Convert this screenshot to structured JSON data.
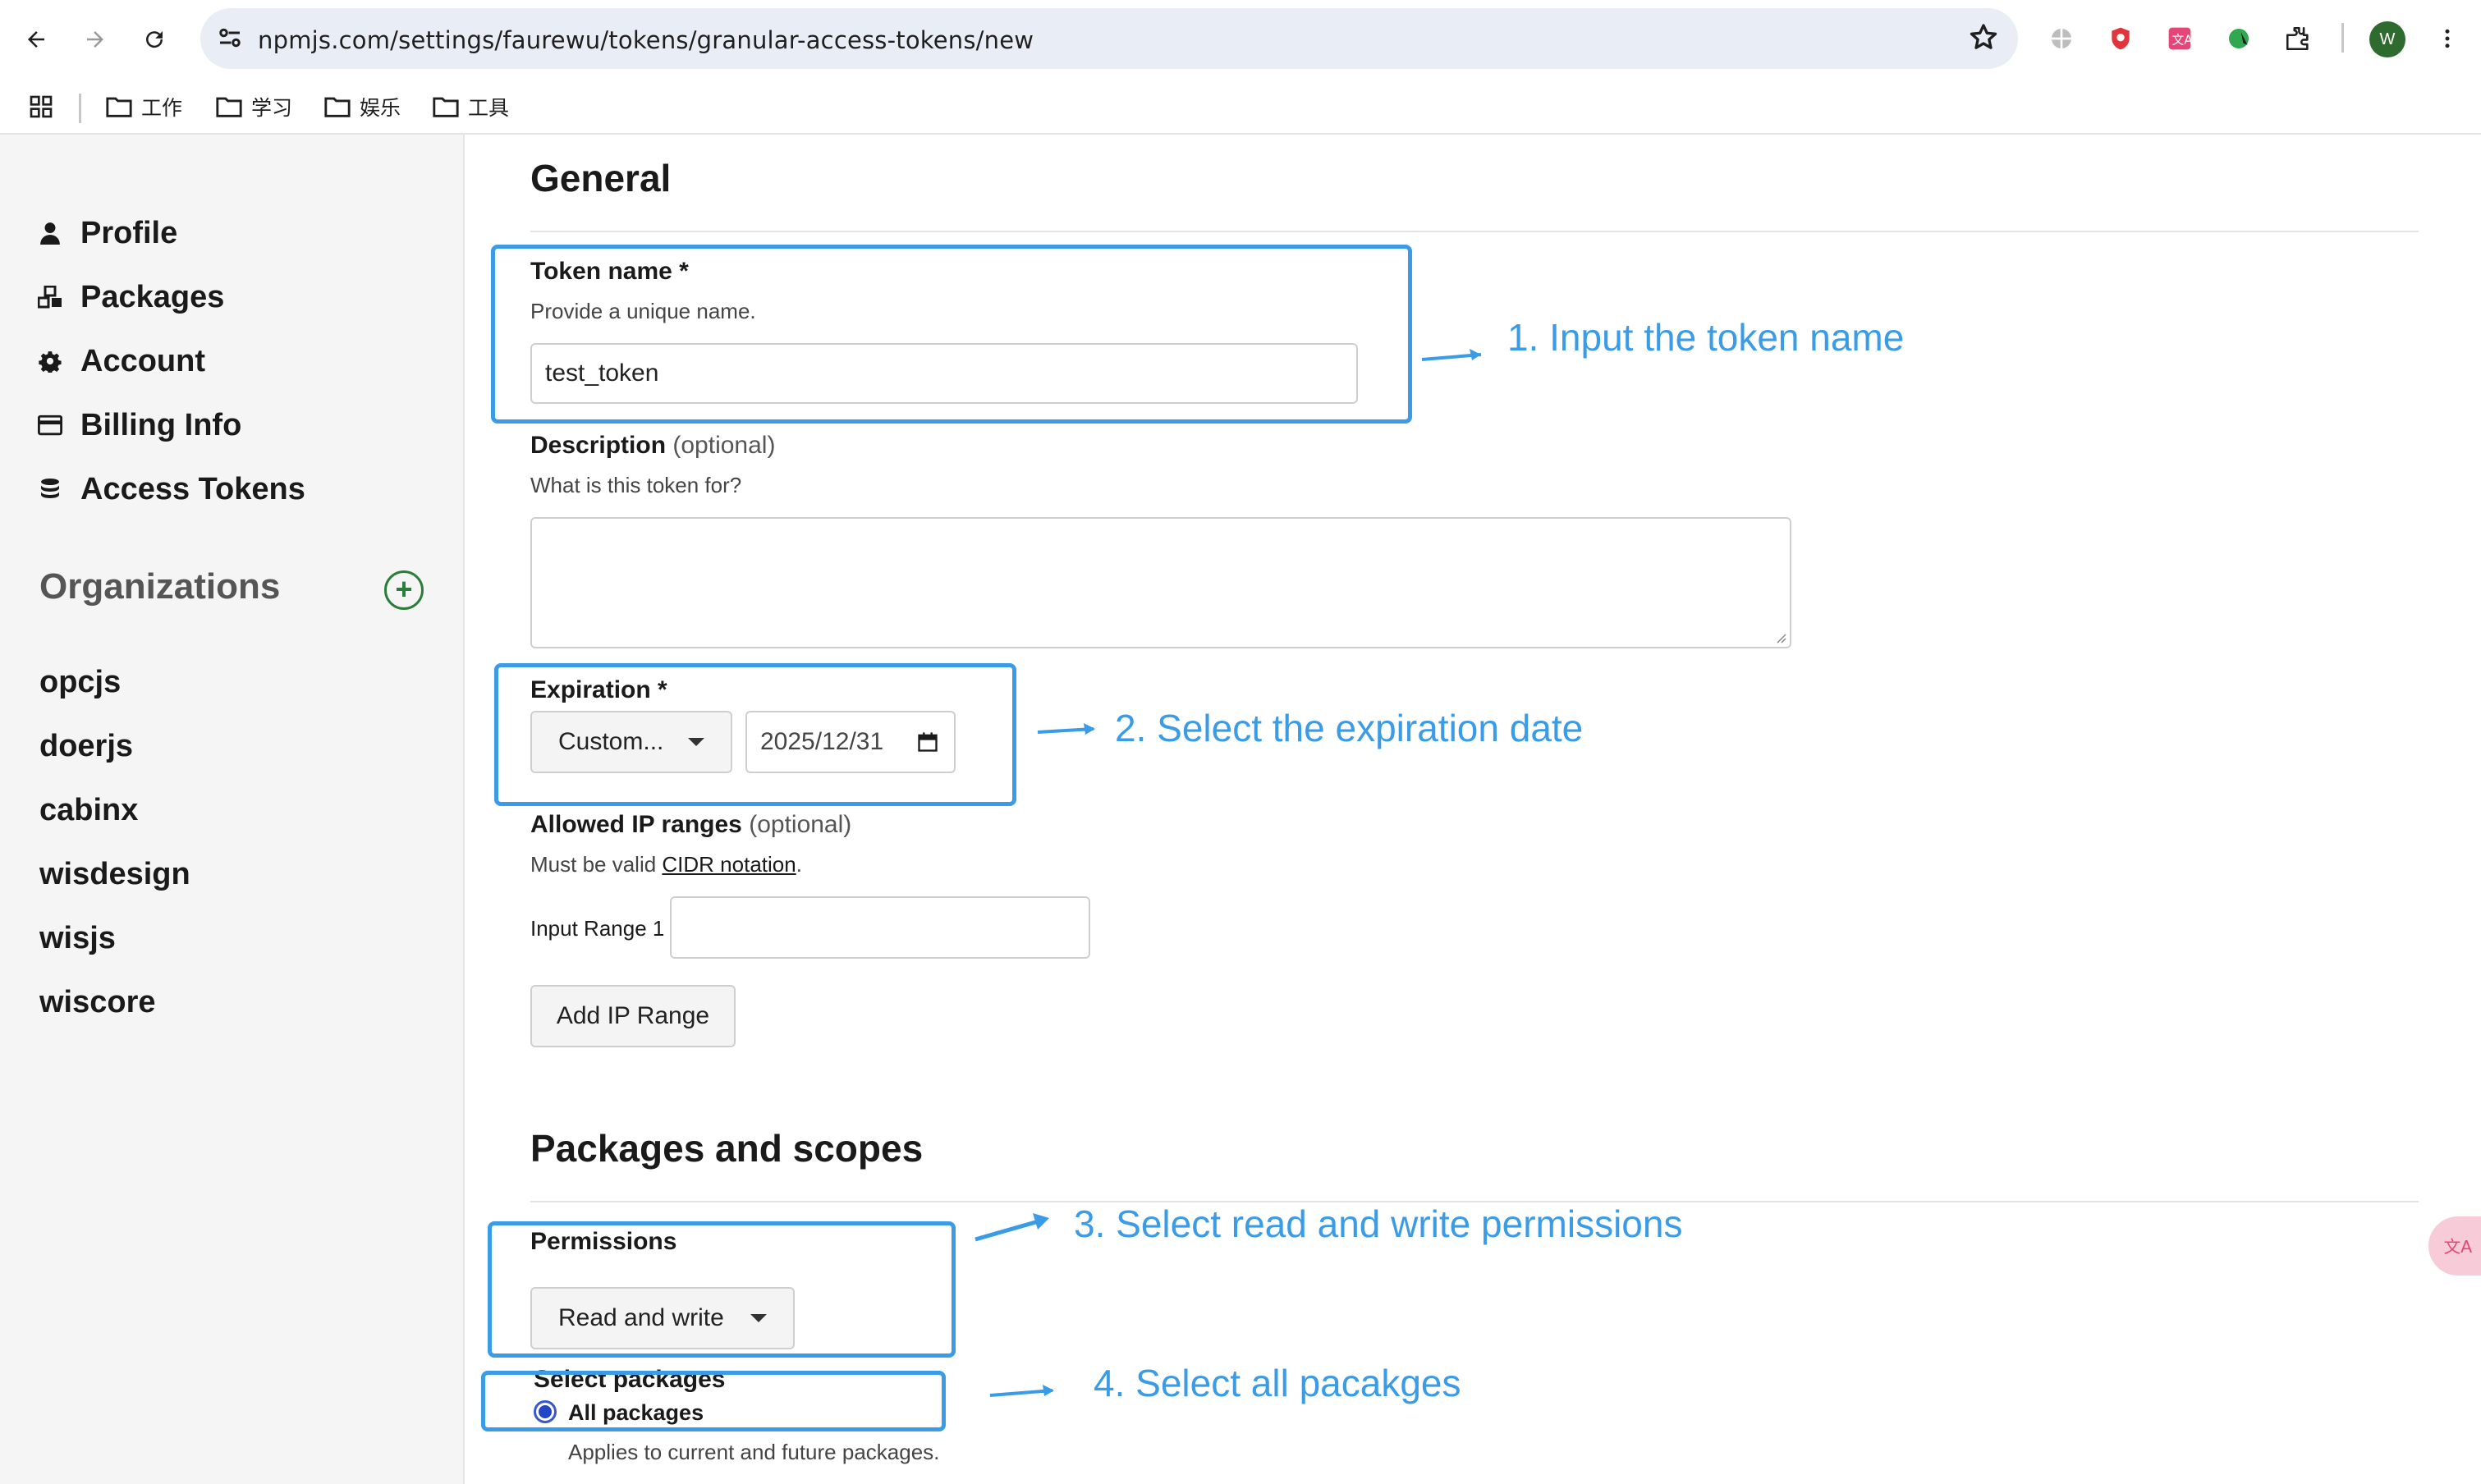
{
  "browser": {
    "url": "npmjs.com/settings/faurewu/tokens/granular-access-tokens/new",
    "profile_initial": "W",
    "bookmarks": [
      "工作",
      "学习",
      "娱乐",
      "工具"
    ]
  },
  "sidebar": {
    "items": [
      {
        "label": "Profile",
        "icon": "user-icon"
      },
      {
        "label": "Packages",
        "icon": "packages-icon"
      },
      {
        "label": "Account",
        "icon": "gear-icon"
      },
      {
        "label": "Billing Info",
        "icon": "credit-card-icon"
      },
      {
        "label": "Access Tokens",
        "icon": "coins-icon"
      }
    ],
    "organizations_title": "Organizations",
    "add_org": "+",
    "organizations": [
      "opcjs",
      "doerjs",
      "cabinx",
      "wisdesign",
      "wisjs",
      "wiscore"
    ]
  },
  "general": {
    "title": "General",
    "token_name_label": "Token name *",
    "token_name_help": "Provide a unique name.",
    "token_name_value": "test_token",
    "description_label": "Description",
    "description_optional": "(optional)",
    "description_help": "What is this token for?",
    "expiration_label": "Expiration *",
    "expiration_select": "Custom...",
    "expiration_date": "2025/12/31",
    "ip_label": "Allowed IP ranges",
    "ip_optional": "(optional)",
    "ip_help_prefix": "Must be valid ",
    "ip_help_link": "CIDR notation",
    "ip_help_suffix": ".",
    "ip_input_label": "Input Range 1",
    "add_ip_button": "Add IP Range"
  },
  "packages": {
    "title": "Packages and scopes",
    "permissions_label": "Permissions",
    "permissions_value": "Read and write",
    "select_packages_label": "Select packages",
    "all_packages_label": "All packages",
    "all_packages_help": "Applies to current and future packages."
  },
  "annotations": {
    "step1": "1. Input the token name",
    "step2": "2. Select the expiration date",
    "step3": "3. Select read and write permissions",
    "step4": "4. Select all pacakges"
  },
  "colors": {
    "annotation": "#3a9be6",
    "org_add": "#2a7d3a",
    "sidebar_bg": "#f5f5f5"
  }
}
